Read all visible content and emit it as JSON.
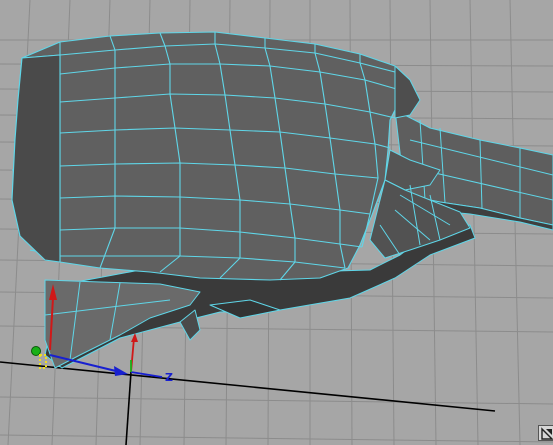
{
  "viewport": {
    "background_color": "#a6a6a6",
    "grid_color": "#8c8c8c",
    "axis_color": "#000000",
    "mesh_face_color": "#5e5e5e",
    "mesh_shadow_color": "#3a3a3a",
    "mesh_wire_color": "#5fd6e8"
  },
  "manipulator": {
    "z_label": "Z",
    "x_axis_color": "#d01818",
    "y_axis_color": "#18b018",
    "z_axis_color": "#1820d0",
    "handle_color": "#f0e020"
  },
  "corner_icon": {
    "name": "view-cube-icon"
  }
}
